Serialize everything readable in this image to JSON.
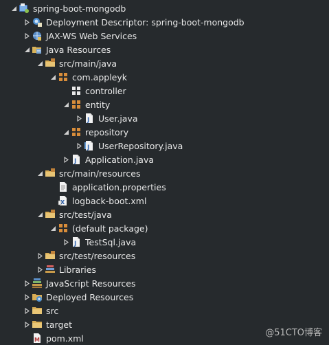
{
  "tree": [
    {
      "name": "project-spring-boot-mongodb",
      "label": "spring-boot-mongodb",
      "depth": 0,
      "arrow": "expanded",
      "icon": "project-icon"
    },
    {
      "name": "deployment-descriptor",
      "label": "Deployment Descriptor: spring-boot-mongodb",
      "depth": 1,
      "arrow": "collapsed",
      "icon": "deployment-descriptor-icon"
    },
    {
      "name": "jax-ws-web-services",
      "label": "JAX-WS Web Services",
      "depth": 1,
      "arrow": "collapsed",
      "icon": "web-services-icon"
    },
    {
      "name": "java-resources",
      "label": "Java Resources",
      "depth": 1,
      "arrow": "expanded",
      "icon": "java-resources-icon"
    },
    {
      "name": "src-main-java",
      "label": "src/main/java",
      "depth": 2,
      "arrow": "expanded",
      "icon": "source-folder-icon"
    },
    {
      "name": "package-com-appleyk",
      "label": "com.appleyk",
      "depth": 3,
      "arrow": "expanded",
      "icon": "package-icon"
    },
    {
      "name": "package-controller",
      "label": "controller",
      "depth": 4,
      "arrow": "none",
      "icon": "empty-package-icon"
    },
    {
      "name": "package-entity",
      "label": "entity",
      "depth": 4,
      "arrow": "expanded",
      "icon": "package-icon"
    },
    {
      "name": "file-user-java",
      "label": "User.java",
      "depth": 5,
      "arrow": "collapsed",
      "icon": "java-file-icon"
    },
    {
      "name": "package-repository",
      "label": "repository",
      "depth": 4,
      "arrow": "expanded",
      "icon": "package-icon"
    },
    {
      "name": "file-userrepository-java",
      "label": "UserRepository.java",
      "depth": 5,
      "arrow": "collapsed",
      "icon": "java-interface-file-icon"
    },
    {
      "name": "file-application-java",
      "label": "Application.java",
      "depth": 4,
      "arrow": "collapsed",
      "icon": "java-file-icon"
    },
    {
      "name": "src-main-resources",
      "label": "src/main/resources",
      "depth": 2,
      "arrow": "expanded",
      "icon": "source-folder-icon"
    },
    {
      "name": "file-application-properties",
      "label": "application.properties",
      "depth": 3,
      "arrow": "none",
      "icon": "properties-file-icon"
    },
    {
      "name": "file-logback-boot-xml",
      "label": "logback-boot.xml",
      "depth": 3,
      "arrow": "none",
      "icon": "xml-file-icon"
    },
    {
      "name": "src-test-java",
      "label": "src/test/java",
      "depth": 2,
      "arrow": "expanded",
      "icon": "source-folder-icon"
    },
    {
      "name": "package-default",
      "label": "(default package)",
      "depth": 3,
      "arrow": "expanded",
      "icon": "package-icon"
    },
    {
      "name": "file-testsql-java",
      "label": "TestSql.java",
      "depth": 4,
      "arrow": "collapsed",
      "icon": "java-file-icon"
    },
    {
      "name": "src-test-resources",
      "label": "src/test/resources",
      "depth": 2,
      "arrow": "collapsed",
      "icon": "source-folder-icon"
    },
    {
      "name": "libraries",
      "label": "Libraries",
      "depth": 2,
      "arrow": "collapsed",
      "icon": "libraries-icon"
    },
    {
      "name": "javascript-resources",
      "label": "JavaScript Resources",
      "depth": 1,
      "arrow": "collapsed",
      "icon": "javascript-resources-icon"
    },
    {
      "name": "deployed-resources",
      "label": "Deployed Resources",
      "depth": 1,
      "arrow": "collapsed",
      "icon": "deployed-resources-icon"
    },
    {
      "name": "folder-src",
      "label": "src",
      "depth": 1,
      "arrow": "collapsed",
      "icon": "folder-icon"
    },
    {
      "name": "folder-target",
      "label": "target",
      "depth": 1,
      "arrow": "collapsed",
      "icon": "folder-icon"
    },
    {
      "name": "file-pom-xml",
      "label": "pom.xml",
      "depth": 1,
      "arrow": "none",
      "icon": "maven-pom-file-icon"
    }
  ],
  "watermark": "@51CTO博客"
}
